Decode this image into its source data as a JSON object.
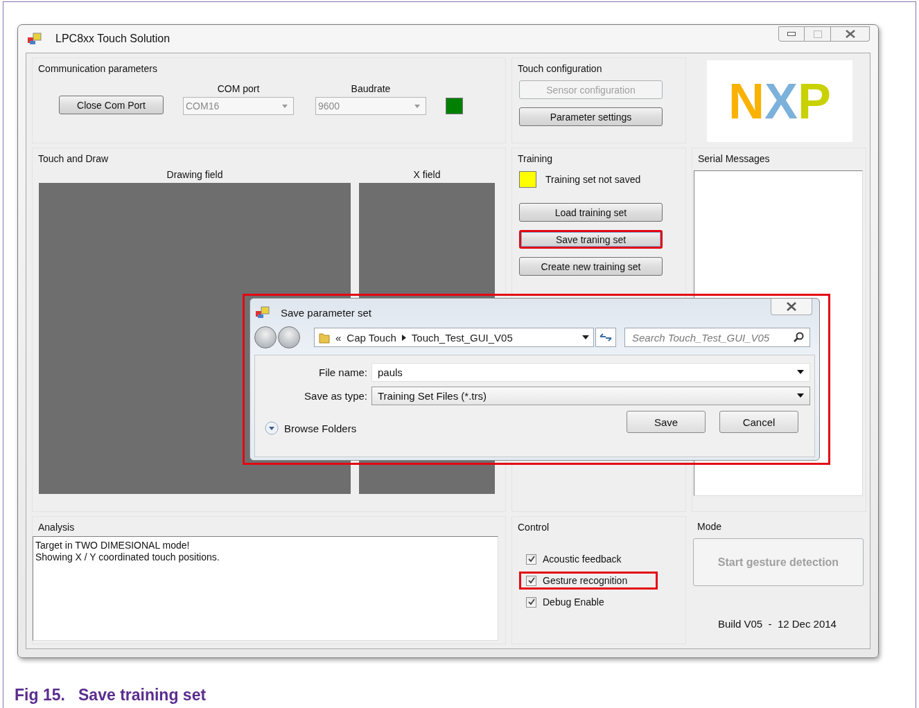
{
  "window": {
    "title": "LPC8xx Touch Solution"
  },
  "communication": {
    "title": "Communication parameters",
    "close_button": "Close Com Port",
    "com_port": {
      "label": "COM port",
      "value": "COM16",
      "disabled": true
    },
    "baudrate": {
      "label": "Baudrate",
      "value": "9600",
      "disabled": true
    },
    "connected": true
  },
  "touch_configuration": {
    "title": "Touch configuration",
    "buttons": [
      {
        "label": "Sensor configuration",
        "disabled": true
      },
      {
        "label": "Parameter settings",
        "disabled": false
      }
    ]
  },
  "logo": "NXP",
  "touch_and_draw": {
    "title": "Touch and Draw",
    "drawing_field": "Drawing field",
    "x_field": "X field"
  },
  "training": {
    "title": "Training",
    "saved": false,
    "status": "Training set not saved",
    "buttons": [
      {
        "label": "Load training set",
        "highlighted": false
      },
      {
        "label": "Save traning set",
        "highlighted": true
      },
      {
        "label": "Create new training set",
        "highlighted": false
      }
    ]
  },
  "serial_messages": {
    "title": "Serial Messages"
  },
  "analysis": {
    "title": "Analysis",
    "lines": [
      "Target in TWO DIMESIONAL mode!",
      "Showing X / Y coordinated touch positions."
    ]
  },
  "control": {
    "title": "Control",
    "options": [
      {
        "label": "Acoustic feedback",
        "checked": true,
        "highlighted": false
      },
      {
        "label": "Gesture recognition",
        "checked": true,
        "highlighted": true
      },
      {
        "label": "Debug Enable",
        "checked": true,
        "highlighted": false
      }
    ]
  },
  "mode": {
    "title": "Mode",
    "button": {
      "label": "Start gesture detection",
      "disabled": true
    }
  },
  "build": "Build V05  -  12 Dec 2014",
  "dialog": {
    "title": "Save parameter set",
    "highlighted": true,
    "path_prefix": "«",
    "path": [
      "Cap Touch",
      "Touch_Test_GUI_V05"
    ],
    "search": {
      "placeholder": "Search Touch_Test_GUI_V05"
    },
    "file_name": {
      "label": "File name:",
      "value": "pauls"
    },
    "save_as_type": {
      "label": "Save as type:",
      "value": "Training Set Files (*.trs)"
    },
    "browse": "Browse Folders",
    "buttons": [
      "Save",
      "Cancel"
    ]
  },
  "caption": "Fig 15.   Save training set"
}
